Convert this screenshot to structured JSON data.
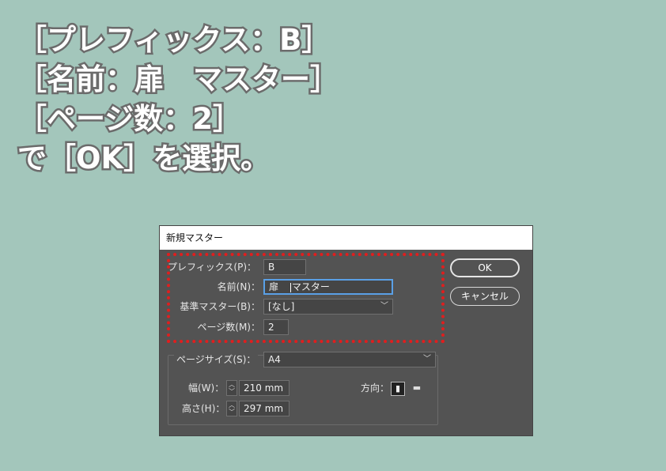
{
  "instructions": {
    "line1": "［プレフィックス：B］",
    "line2": "［名前：扉　マスター］",
    "line3": "［ページ数：2］",
    "line4": "で［OK］を選択。"
  },
  "dialog": {
    "title": "新規マスター",
    "prefix_label": "プレフィックス(P)：",
    "prefix_value": "B",
    "name_label": "名前(N)：",
    "name_value_a": "扉",
    "name_value_b": "マスター",
    "based_on_label": "基準マスター(B)：",
    "based_on_value": "[なし]",
    "pages_label": "ページ数(M)：",
    "pages_value": "2",
    "ok_label": "OK",
    "cancel_label": "キャンセル",
    "page_size_label": "ページサイズ(S)：",
    "page_size_value": "A4",
    "width_label": "幅(W)：",
    "width_value": "210 mm",
    "height_label": "高さ(H)：",
    "height_value": "297 mm",
    "orientation_label": "方向："
  },
  "icons": {
    "dropdown": "chevron-down-icon",
    "stepper": "stepper-icon",
    "portrait": "portrait-icon",
    "landscape": "landscape-icon"
  },
  "colors": {
    "background": "#a3c6bb",
    "dialog": "#535353",
    "highlight": "#e01e1e",
    "focus": "#5aa0e6"
  }
}
